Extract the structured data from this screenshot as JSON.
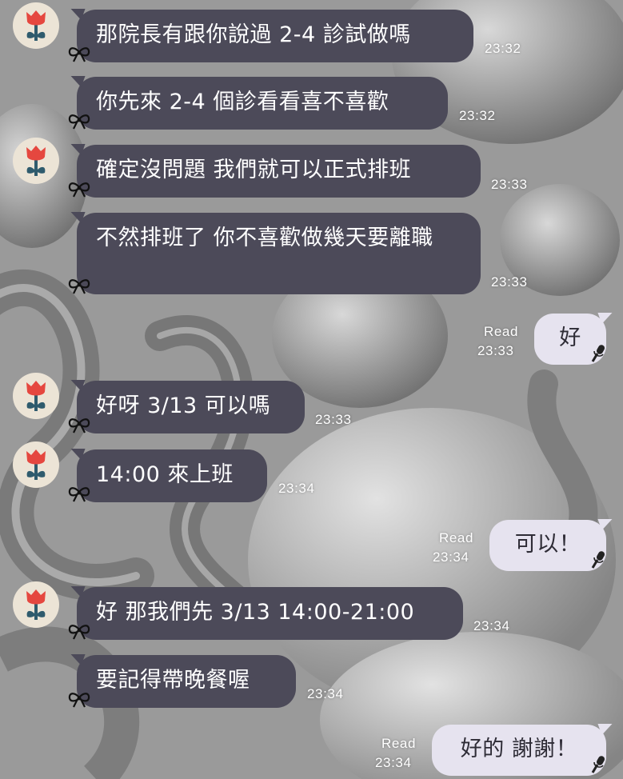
{
  "messages": [
    {
      "side": "in",
      "avatar": true,
      "text": "那院長有跟你說過 2-4 診試做嗎",
      "time": "23:32"
    },
    {
      "side": "in",
      "avatar": false,
      "text": "你先來 2-4 個診看看喜不喜歡",
      "time": "23:32"
    },
    {
      "side": "in",
      "avatar": true,
      "text": "確定沒問題 我們就可以正式排班",
      "time": "23:33"
    },
    {
      "side": "in",
      "avatar": false,
      "text": "不然排班了 你不喜歡做幾天要離職",
      "time": "23:33"
    },
    {
      "side": "out",
      "text": "好",
      "status": "Read",
      "time": "23:33"
    },
    {
      "side": "in",
      "avatar": true,
      "text": "好呀 3/13 可以嗎",
      "time": "23:33"
    },
    {
      "side": "in",
      "avatar": true,
      "text": "14:00 來上班",
      "time": "23:34"
    },
    {
      "side": "out",
      "text": "可以！",
      "status": "Read",
      "time": "23:34"
    },
    {
      "side": "in",
      "avatar": true,
      "text": "好 那我們先 3/13 14:00-21:00",
      "time": "23:34"
    },
    {
      "side": "in",
      "avatar": false,
      "text": "要記得帶晚餐喔",
      "time": "23:34"
    },
    {
      "side": "out",
      "text": "好的 謝謝！",
      "status": "Read",
      "time": "23:34"
    }
  ],
  "icons": {
    "avatar": "red-tulip-avatar-icon",
    "bow": "bow-ribbon-icon",
    "mic": "microphone-icon"
  },
  "colors": {
    "incoming_bubble": "#4c4a59",
    "outgoing_bubble": "#e6e3ef",
    "avatar_bg": "#ece4d6",
    "flower_red": "#e5473f",
    "flower_stem": "#2f5b6d"
  }
}
